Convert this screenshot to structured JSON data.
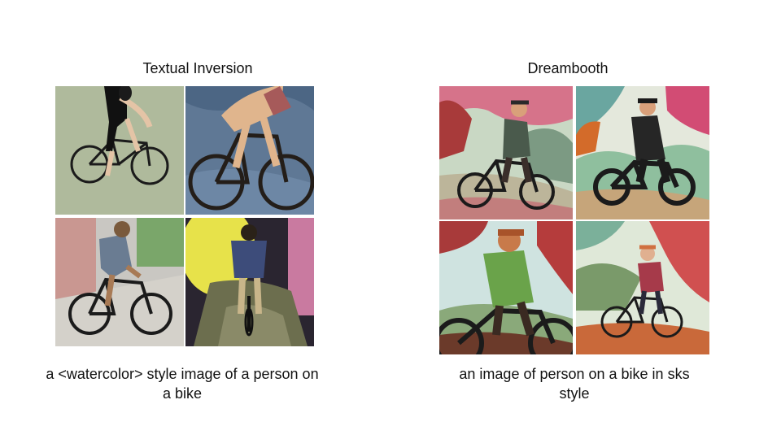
{
  "slide": {
    "left": {
      "title": "Textual Inversion",
      "caption": "a <watercolor> style image of a person on a bike",
      "images": [
        "cyclist-sketch-green",
        "cyclist-blue-textured",
        "cyclist-street",
        "cyclist-yellow-glow"
      ]
    },
    "right": {
      "title": "Dreambooth",
      "caption": "an image of person on a bike in sks style",
      "images": [
        "cyclist-painted-pink-sky",
        "cyclist-painted-teal",
        "cyclist-painted-green-shirt",
        "cyclist-painted-red-shirt"
      ]
    }
  }
}
